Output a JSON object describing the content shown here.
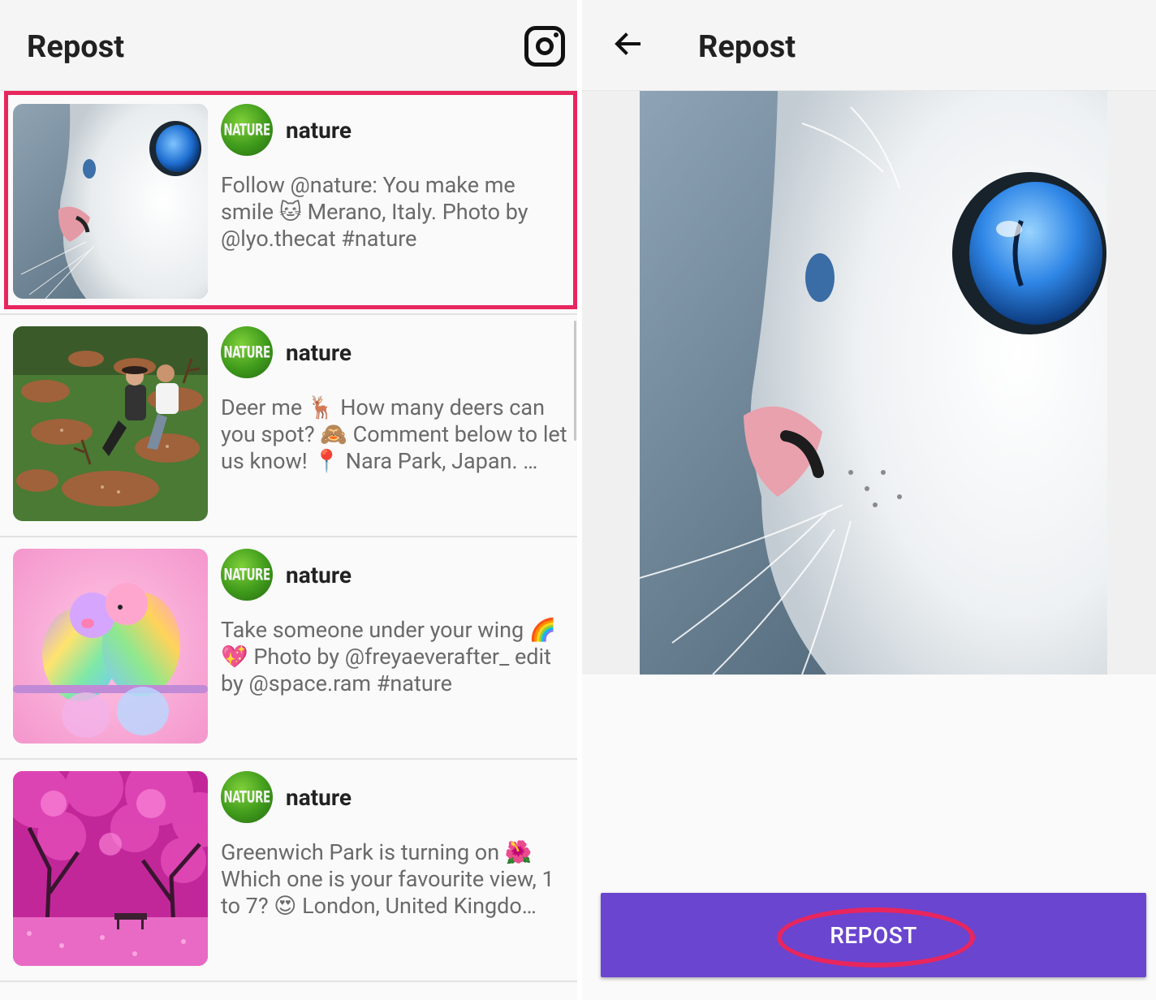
{
  "left_screen": {
    "title": "Repost",
    "instagram_icon": "instagram-icon",
    "posts": [
      {
        "username": "nature",
        "avatar_text": "NATURE",
        "caption": "Follow @nature: You make me smile 🐱 Merano, Italy. Photo by @lyo.thecat #nature",
        "thumb": "cat"
      },
      {
        "username": "nature",
        "avatar_text": "NATURE",
        "caption": "Deer me 🦌 How many deers can you spot? 🙈 Comment below to let us know! 📍 Nara Park, Japan. …",
        "thumb": "deer"
      },
      {
        "username": "nature",
        "avatar_text": "NATURE",
        "caption": "Take someone under your wing 🌈💖 Photo by @freyaeverafter_ edit by @space.ram #nature",
        "thumb": "birds"
      },
      {
        "username": "nature",
        "avatar_text": "NATURE",
        "caption": "Greenwich Park is turning on 🌺 Which one is your favourite view, 1 to 7? 😍 London, United Kingdo…",
        "thumb": "trees"
      }
    ]
  },
  "right_screen": {
    "title": "Repost",
    "back_icon": "arrow-back-icon",
    "repost_button_label": "REPOST"
  },
  "colors": {
    "accent": "#6a45cf",
    "highlight": "#e8265e",
    "avatar_green": "#3f9a1b"
  }
}
